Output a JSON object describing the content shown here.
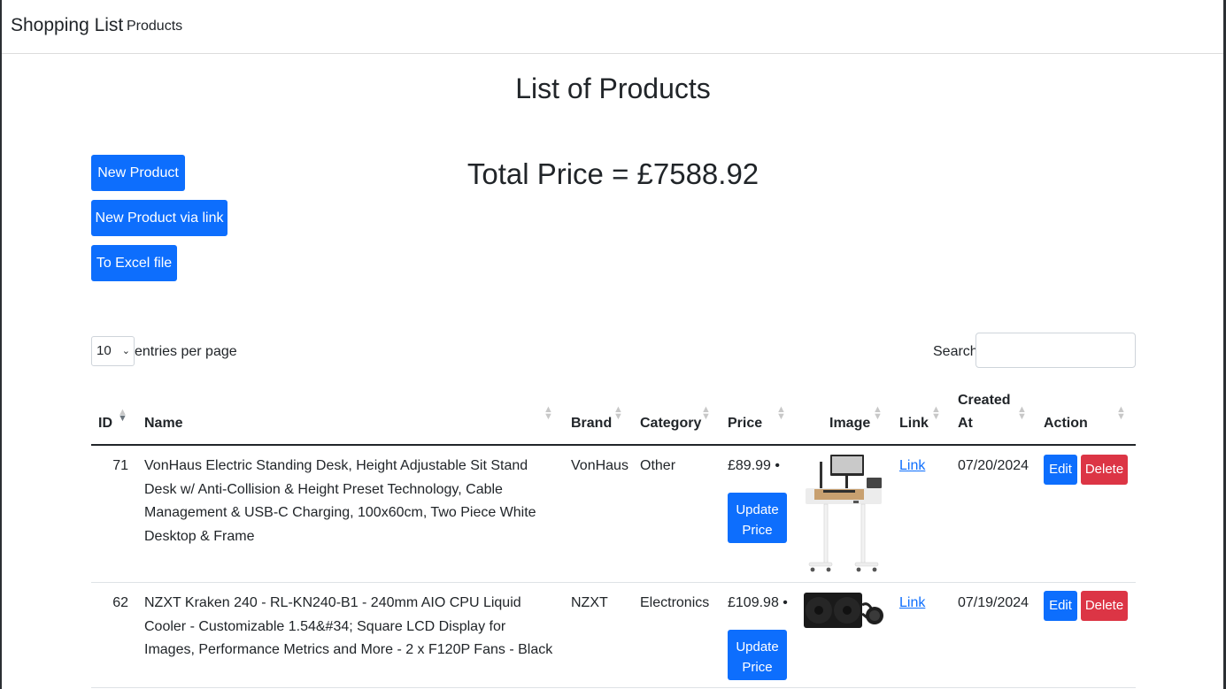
{
  "navbar": {
    "brand": "Shopping List",
    "links": [
      "Products"
    ]
  },
  "page": {
    "title": "List of Products",
    "total_price": "Total Price = £7588.92"
  },
  "actions": {
    "new_product": "New Product",
    "new_product_link": "New Product via link",
    "to_excel": "To Excel file"
  },
  "table_controls": {
    "entries_value": "10",
    "entries_label": "entries per page",
    "search_label": "Search:",
    "search_value": ""
  },
  "table": {
    "columns": [
      "ID",
      "Name",
      "Brand",
      "Category",
      "Price",
      "Image",
      "Link",
      "Created At",
      "Action"
    ],
    "created_at_line1": "Created",
    "created_at_line2": "At",
    "rows": [
      {
        "id": "71",
        "name": "VonHaus Electric Standing Desk, Height Adjustable Sit Stand Desk w/ Anti-Collision & Height Preset Technology, Cable Management & USB-C Charging, 100x60cm, Two Piece White Desktop & Frame",
        "brand": "VonHaus",
        "category": "Other",
        "price": "£89.99 •",
        "update_label": "Update Price",
        "image": "standing-desk-image",
        "link": "Link",
        "created_at": "07/20/2024",
        "edit": "Edit",
        "delete": "Delete"
      },
      {
        "id": "62",
        "name": "NZXT Kraken 240 - RL-KN240-B1 - 240mm AIO CPU Liquid Cooler - Customizable 1.54&#34; Square LCD Display for Images, Performance Metrics and More - 2 x F120P Fans - Black",
        "brand": "NZXT",
        "category": "Electronics",
        "price": "£109.98 •",
        "update_label": "Update Price",
        "image": "liquid-cooler-image",
        "link": "Link",
        "created_at": "07/19/2024",
        "edit": "Edit",
        "delete": "Delete"
      }
    ]
  },
  "colors": {
    "primary": "#0d6efd",
    "danger": "#dc3545",
    "text": "#212529"
  }
}
